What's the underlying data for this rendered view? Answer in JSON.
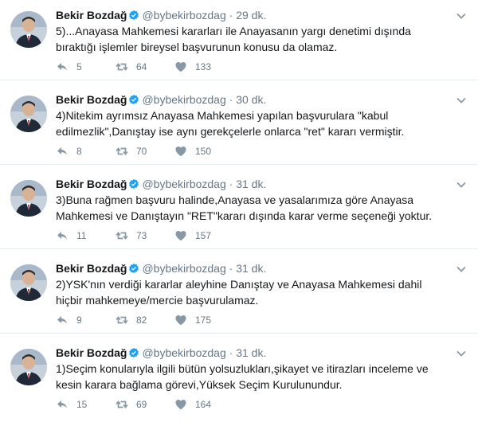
{
  "tweets": [
    {
      "name": "Bekir Bozdağ",
      "handle": "@bybekirbozdag",
      "separator": "·",
      "time": "29 dk.",
      "text": "5)...Anayasa Mahkemesi kararları ile Anayasanın yargı denetimi dışında bıraktığı işlemler bireysel başvurunun konusu da olamaz.",
      "replies": "5",
      "retweets": "64",
      "likes": "133"
    },
    {
      "name": "Bekir Bozdağ",
      "handle": "@bybekirbozdag",
      "separator": "·",
      "time": "30 dk.",
      "text": "4)Nitekim ayrımsız Anayasa Mahkemesi yapılan başvurulara \"kabul edilmezlik\",Danıştay ise aynı gerekçelerle onlarca \"ret\" kararı vermiştir.",
      "replies": "8",
      "retweets": "70",
      "likes": "150"
    },
    {
      "name": "Bekir Bozdağ",
      "handle": "@bybekirbozdag",
      "separator": "·",
      "time": "31 dk.",
      "text": "3)Buna rağmen başvuru halinde,Anayasa ve yasalarımıza göre Anayasa Mahkemesi ve Danıştayın \"RET\"kararı dışında karar verme seçeneği yoktur.",
      "replies": "11",
      "retweets": "73",
      "likes": "157"
    },
    {
      "name": "Bekir Bozdağ",
      "handle": "@bybekirbozdag",
      "separator": "·",
      "time": "31 dk.",
      "text": "2)YSK'nın verdiği kararlar aleyhine Danıştay ve Anayasa Mahkemesi dahil hiçbir mahkemeye/mercie başvurulamaz.",
      "replies": "9",
      "retweets": "82",
      "likes": "175"
    },
    {
      "name": "Bekir Bozdağ",
      "handle": "@bybekirbozdag",
      "separator": "·",
      "time": "31 dk.",
      "text": "1)Seçim konularıyla ilgili bütün yolsuzlukları,şikayet ve itirazları inceleme ve kesin karara bağlama görevi,Yüksek Seçim Kurulunundur.",
      "replies": "15",
      "retweets": "69",
      "likes": "164"
    }
  ],
  "icons": {
    "reply": "reply-icon",
    "retweet": "retweet-icon",
    "like": "heart-icon",
    "verified": "verified-badge-icon",
    "caret": "chevron-down-icon"
  },
  "colors": {
    "verified": "#1da1f2",
    "icon": "#8899a6",
    "secondary_text": "#657786",
    "divider": "#e6ecf0"
  }
}
